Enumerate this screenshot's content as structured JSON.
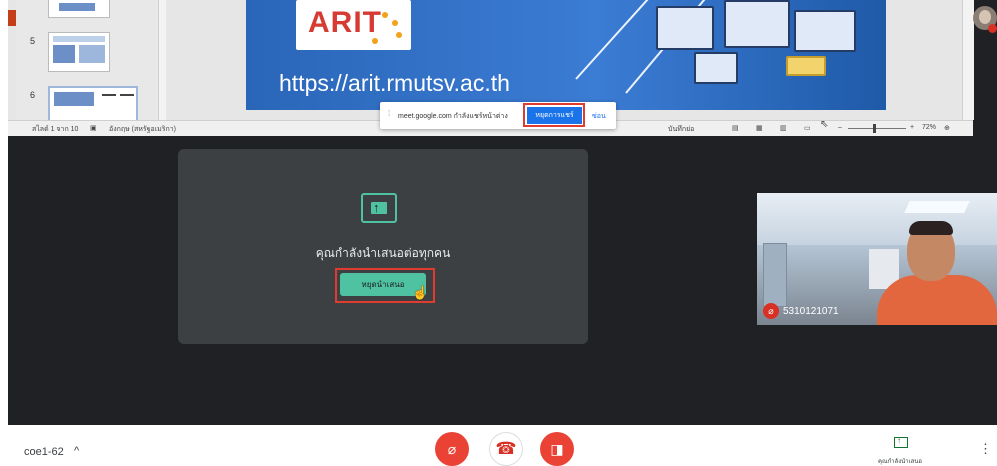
{
  "ppt": {
    "thumbs": [
      {
        "num": "5"
      },
      {
        "num": "6"
      }
    ],
    "slide_url": "https://arit.rmutsv.ac.th",
    "logo_text": "ARIT",
    "status_slide": "สไลด์ 1 จาก 10",
    "status_lang": "อังกฤษ (สหรัฐอเมริกา)",
    "status_notes": "บันทึกย่อ",
    "zoom": "72%"
  },
  "share_bar": {
    "message": "meet.google.com กำลังแชร์หน้าต่าง",
    "stop_label": "หยุดการแชร์",
    "hide_label": "ซ่อน"
  },
  "presenting": {
    "message": "คุณกำลังนำเสนอต่อทุกคน",
    "stop_label": "หยุดนำเสนอ"
  },
  "participant": {
    "name": "5310121071"
  },
  "bottom": {
    "meeting_code": "coe1-62",
    "presenting_label": "คุณกำลังนำเสนอ"
  },
  "colors": {
    "stage_bg": "#202124",
    "accent_green": "#4fc3a1",
    "red": "#ea4335",
    "share_blue": "#1a73e8",
    "highlight_red": "#e03b2f"
  },
  "icons": [
    "share-screen-icon",
    "mic-off-icon",
    "hang-up-icon",
    "camera-off-icon",
    "chevron-up-icon",
    "more-vert-icon",
    "hand-cursor-icon"
  ]
}
